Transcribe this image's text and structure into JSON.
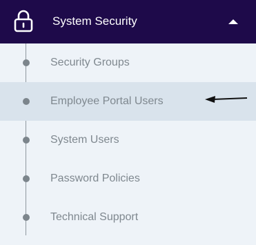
{
  "header": {
    "title": "System Security",
    "lock_icon": "lock-icon",
    "toggle_icon": "chevron-up-icon",
    "background_color": "#1e0a4a",
    "expanded": true
  },
  "submenu": {
    "items": [
      {
        "label": "Security Groups",
        "active": false
      },
      {
        "label": "Employee Portal Users",
        "active": true
      },
      {
        "label": "System Users",
        "active": false
      },
      {
        "label": "Password Policies",
        "active": false
      },
      {
        "label": "Technical Support",
        "active": false
      }
    ],
    "background_color": "#eef3f8",
    "active_background_color": "#d9e3ec",
    "label_color": "#7f888f"
  },
  "annotation": {
    "icon": "arrow-left-icon",
    "points_to": "Employee Portal Users"
  }
}
